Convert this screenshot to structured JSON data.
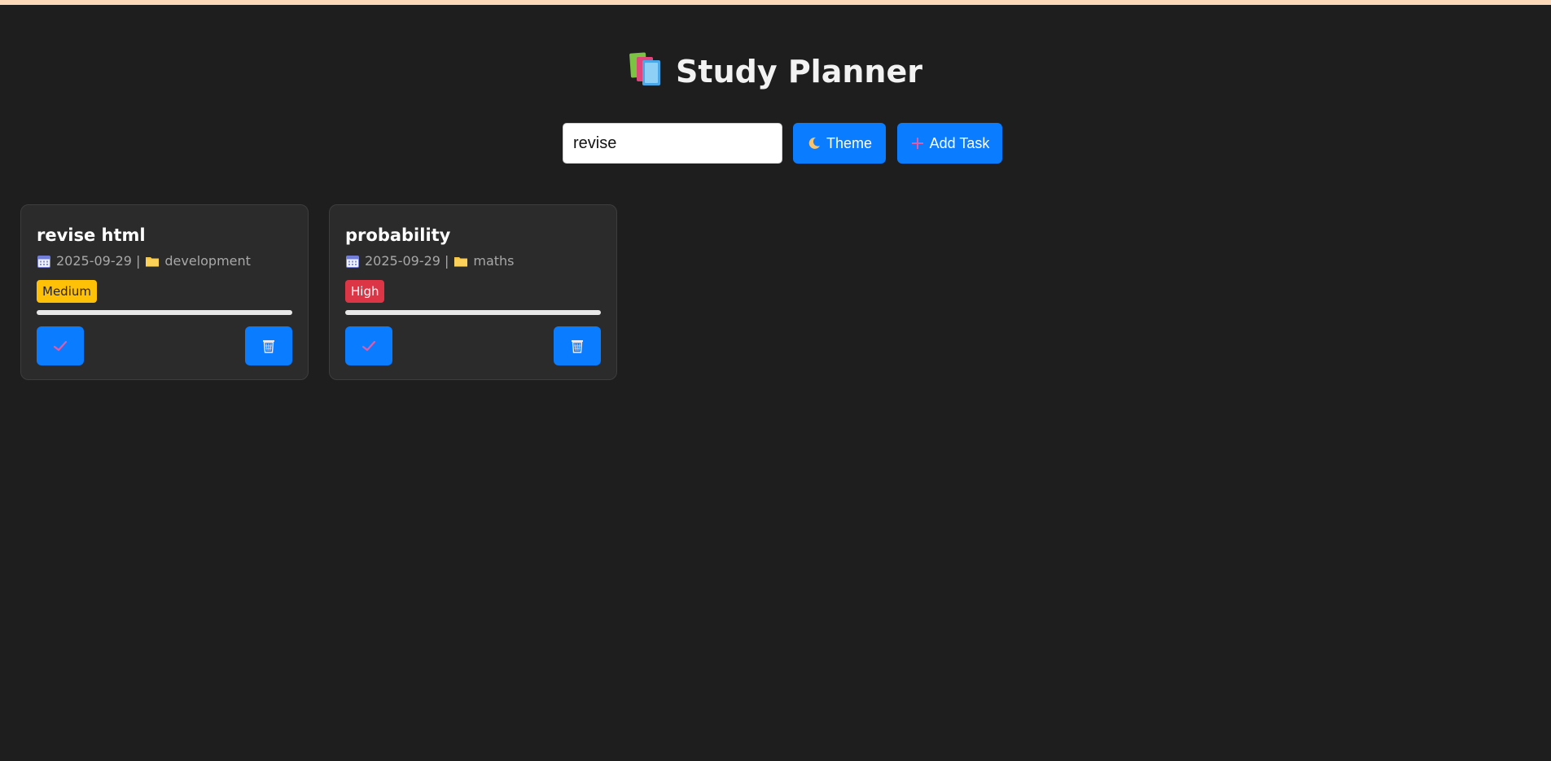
{
  "header": {
    "title": "Study Planner",
    "icon": "books-icon"
  },
  "toolbar": {
    "search_value": "revise",
    "theme_label": "Theme",
    "theme_icon": "moon-icon",
    "add_label": "Add Task",
    "add_icon": "plus-icon"
  },
  "colors": {
    "background": "#1e1e1e",
    "card": "#2b2b2b",
    "accent": "#0a7cff",
    "priority_medium": "#ffc107",
    "priority_high": "#dc3545"
  },
  "tasks": [
    {
      "title": "revise html",
      "date": "2025-09-29",
      "separator": "|",
      "category": "development",
      "priority": "Medium",
      "progress": 0,
      "complete_icon": "checkmark-icon",
      "delete_icon": "trash-icon"
    },
    {
      "title": "probability",
      "date": "2025-09-29",
      "separator": "|",
      "category": "maths",
      "priority": "High",
      "progress": 0,
      "complete_icon": "checkmark-icon",
      "delete_icon": "trash-icon"
    }
  ]
}
